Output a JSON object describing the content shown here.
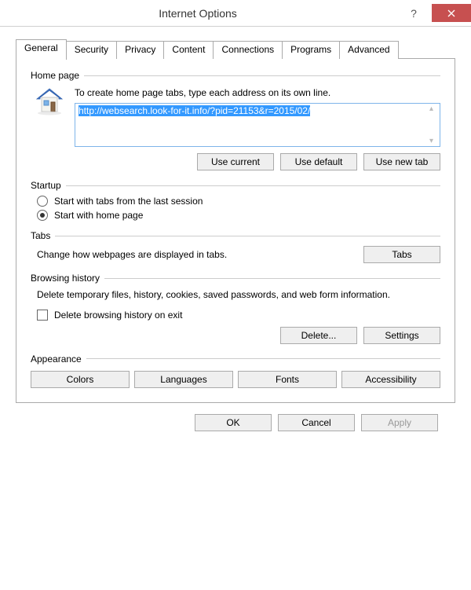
{
  "window": {
    "title": "Internet Options"
  },
  "tabs": {
    "t0": "General",
    "t1": "Security",
    "t2": "Privacy",
    "t3": "Content",
    "t4": "Connections",
    "t5": "Programs",
    "t6": "Advanced"
  },
  "homepage": {
    "label": "Home page",
    "instruction": "To create home page tabs, type each address on its own line.",
    "url": "http://websearch.look-for-it.info/?pid=21153&r=2015/02/",
    "use_current": "Use current",
    "use_default": "Use default",
    "use_new_tab": "Use new tab"
  },
  "startup": {
    "label": "Startup",
    "opt_last": "Start with tabs from the last session",
    "opt_home": "Start with home page"
  },
  "tabs_section": {
    "label": "Tabs",
    "text": "Change how webpages are displayed in tabs.",
    "button": "Tabs"
  },
  "history": {
    "label": "Browsing history",
    "text": "Delete temporary files, history, cookies, saved passwords, and web form information.",
    "check_label": "Delete browsing history on exit",
    "delete": "Delete...",
    "settings": "Settings"
  },
  "appearance": {
    "label": "Appearance",
    "colors": "Colors",
    "languages": "Languages",
    "fonts": "Fonts",
    "accessibility": "Accessibility"
  },
  "footer": {
    "ok": "OK",
    "cancel": "Cancel",
    "apply": "Apply"
  }
}
